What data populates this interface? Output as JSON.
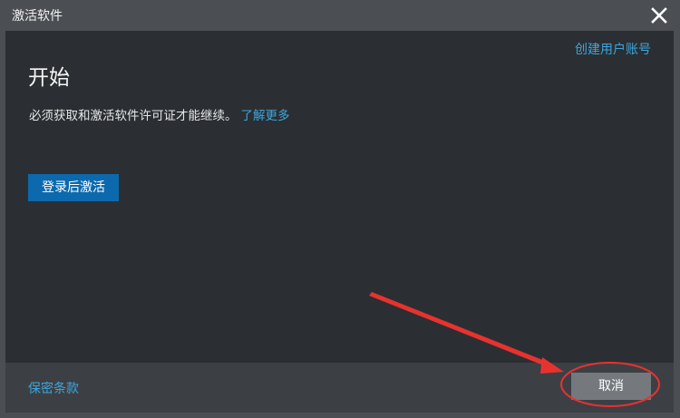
{
  "window": {
    "title": "激活软件"
  },
  "header": {
    "create_account": "创建用户账号"
  },
  "main": {
    "heading": "开始",
    "description": "必须获取和激活软件许可证才能继续。",
    "learn_more": "了解更多",
    "signin_button": "登录后激活"
  },
  "footer": {
    "privacy": "保密条款",
    "cancel_button": "取消"
  },
  "icons": {
    "close": "close-icon"
  },
  "colors": {
    "background": "#2b2f33",
    "titlebar": "#4b4e53",
    "footer": "#3c4045",
    "link": "#3da6de",
    "primary_button": "#0d69ad",
    "cancel_button": "#75797e",
    "annotation": "#e8322e"
  }
}
